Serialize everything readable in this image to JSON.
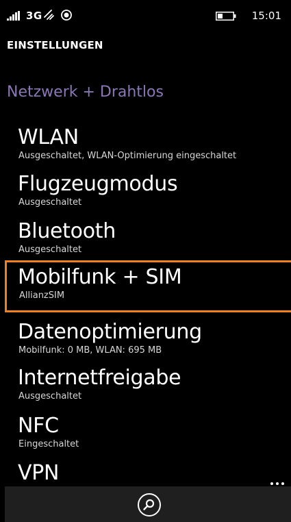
{
  "status_bar": {
    "network_type": "3G",
    "time": "15:01",
    "icons": [
      "signal-icon",
      "data-transfer-icon",
      "location-icon",
      "battery-icon"
    ]
  },
  "header": {
    "title": "EINSTELLUNGEN",
    "section": "Netzwerk + Drahtlos"
  },
  "colors": {
    "accent": "#8a76b5",
    "highlight_border": "#f0811f",
    "app_bar": "#1f1f1f"
  },
  "settings": [
    {
      "label": "WLAN",
      "sublabel": "Ausgeschaltet, WLAN-Optimierung eingeschaltet"
    },
    {
      "label": "Flugzeugmodus",
      "sublabel": "Ausgeschaltet"
    },
    {
      "label": "Bluetooth",
      "sublabel": "Ausgeschaltet"
    },
    {
      "label": "Mobilfunk + SIM",
      "sublabel": "AllianzSIM",
      "selected": true
    },
    {
      "label": "Datenoptimierung",
      "sublabel": "Mobilfunk: 0 MB, WLAN: 695 MB"
    },
    {
      "label": "Internetfreigabe",
      "sublabel": "Ausgeschaltet"
    },
    {
      "label": "NFC",
      "sublabel": "Eingeschaltet"
    },
    {
      "label": "VPN",
      "sublabel": ""
    }
  ],
  "app_bar": {
    "buttons": [
      "search-icon",
      "more-options-icon"
    ]
  }
}
